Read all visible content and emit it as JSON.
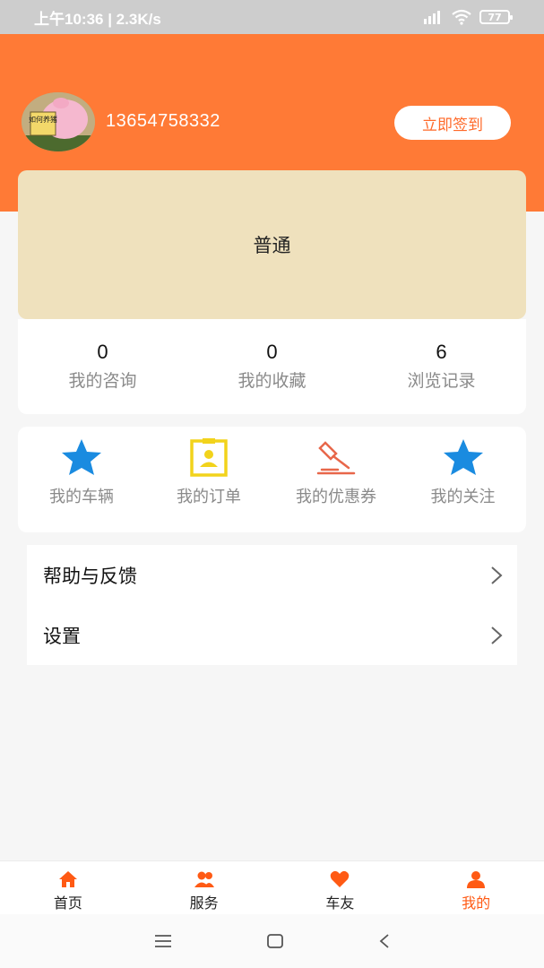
{
  "status": {
    "time": "上午10:36 | 2.3K/s",
    "battery": "77"
  },
  "profile": {
    "phone": "13654758332",
    "signin_label": "立即签到",
    "avatar_text": "如何养猪"
  },
  "level": {
    "label": "普通"
  },
  "stats": [
    {
      "value": "0",
      "label": "我的咨询"
    },
    {
      "value": "0",
      "label": "我的收藏"
    },
    {
      "value": "6",
      "label": "浏览记录"
    }
  ],
  "menu": [
    {
      "label": "我的车辆",
      "icon": "star-icon",
      "color": "#1a8be0"
    },
    {
      "label": "我的订单",
      "icon": "clipboard-user-icon",
      "color": "#f2d31b"
    },
    {
      "label": "我的优惠券",
      "icon": "gavel-icon",
      "color": "#e8674a"
    },
    {
      "label": "我的关注",
      "icon": "star-icon",
      "color": "#1a8be0"
    }
  ],
  "list": [
    {
      "label": "帮助与反馈"
    },
    {
      "label": "设置"
    }
  ],
  "tabs": [
    {
      "label": "首页",
      "icon": "home-icon"
    },
    {
      "label": "服务",
      "icon": "users-icon"
    },
    {
      "label": "车友",
      "icon": "heart-icon"
    },
    {
      "label": "我的",
      "icon": "user-icon",
      "active": true
    }
  ],
  "colors": {
    "accent": "#ff7a36",
    "tab_active": "#ff5a14",
    "level_bg": "#efe1bd"
  }
}
